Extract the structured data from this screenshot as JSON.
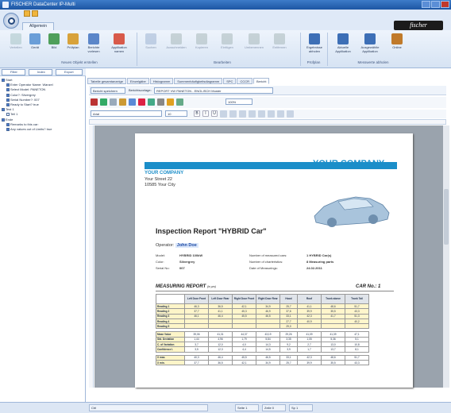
{
  "window": {
    "title": "FISCHER DataCenter IP-Multi"
  },
  "ribbon": {
    "tab_active": "Allgemein",
    "brand": "fischer",
    "buttons": [
      {
        "label": "Verteilen",
        "enabled": false
      },
      {
        "label": "Gerät",
        "enabled": true
      },
      {
        "label": "Bild",
        "enabled": true
      },
      {
        "label": "Prüfplan",
        "enabled": true
      },
      {
        "label": "Berichte vorlesen",
        "enabled": true
      },
      {
        "label": "Applikation namen",
        "enabled": true
      },
      {
        "label": "Suchen",
        "enabled": false
      },
      {
        "label": "Ausschneiden",
        "enabled": false
      },
      {
        "label": "Kopieren",
        "enabled": false
      },
      {
        "label": "Einfügen",
        "enabled": false
      },
      {
        "label": "Umbenennen",
        "enabled": false
      },
      {
        "label": "Entfernen",
        "enabled": false
      },
      {
        "label": "Ergebnisse abholen",
        "enabled": true
      },
      {
        "label": "Aktuelle Applikation",
        "enabled": true
      },
      {
        "label": "Ausgewählte Applikation",
        "enabled": true
      },
      {
        "label": "Online",
        "enabled": true
      }
    ],
    "groups": [
      "Neues Objekt erstellen",
      "Bearbeiten",
      "Prüfplan",
      "Messwerte abholen"
    ]
  },
  "left_panel": {
    "filter_label": "Filter",
    "index_label": "Index",
    "export_label": "Export",
    "tree": [
      {
        "indent": 0,
        "label": "Start",
        "checked": true
      },
      {
        "indent": 1,
        "label": "Enter Operator Name: Wanzel",
        "checked": true
      },
      {
        "indent": 1,
        "label": "Select Model: PANETON",
        "checked": true
      },
      {
        "indent": 1,
        "label": "Color?: Silvergrey",
        "checked": true
      },
      {
        "indent": 1,
        "label": "Serial Number?: 007",
        "checked": true
      },
      {
        "indent": 1,
        "label": "Ready to Start? true",
        "checked": true
      },
      {
        "indent": 0,
        "label": "Test 1",
        "checked": true
      },
      {
        "indent": 1,
        "label": "Teil 1",
        "checked": false
      },
      {
        "indent": 0,
        "label": "Ende",
        "checked": true
      },
      {
        "indent": 1,
        "label": "Remarks to this car:",
        "checked": true
      },
      {
        "indent": 1,
        "label": "Any values out of Limits? true",
        "checked": true
      }
    ]
  },
  "content_tabs": [
    "Tabelle gesamtanzeige",
    "Einzelgäbe",
    "Histogramm",
    "Summenhäufigkeitsdiagramm",
    "SPC",
    "CCCR",
    "Bericht"
  ],
  "content_tab_active_index": 6,
  "report_toolbar": {
    "print_button": "Bericht speichern",
    "template_label": "Berichtsvorlage:",
    "template_value": "REPORT VW PANETON - ENGLISCH Muster",
    "zoom_value": "100%",
    "font_value": "Arial",
    "size_value": "10"
  },
  "report": {
    "brand_big": "YOUR COMPANY",
    "company": "YOUR COMPANY",
    "street": "Your Street 22",
    "city": "10585 Your City",
    "title": "Inspection Report \"HYBRID Car\"",
    "operator_label": "Operator:",
    "operator_name": "John Doe",
    "meta_left": [
      {
        "k": "Model:",
        "v": "HYBRID 100kW"
      },
      {
        "k": "Color:",
        "v": "Silvergrey"
      },
      {
        "k": "Serial No:",
        "v": "007"
      }
    ],
    "meta_right": [
      {
        "k": "Number of measured cars:",
        "v": "1 HYBRID Car(s)"
      },
      {
        "k": "Number of charteristics:",
        "v": "8 Measuring parts"
      },
      {
        "k": "Date of Measurings:",
        "v": "24.02.2011"
      }
    ],
    "measuring_title": "MEASURING REPORT",
    "measuring_unit": "(in µm)",
    "car_no": "CAR No.: 1",
    "columns": [
      "",
      "Left Door Front",
      "Left Door Rear",
      "Right Door Front",
      "Right Door Rear",
      "Hood",
      "Roof",
      "Trunk above",
      "Trunk Tail"
    ],
    "rows": [
      [
        "Reading 1",
        "46,3",
        "36,5",
        "42,1",
        "34,9",
        "25,7",
        "41,1",
        "48,6",
        "51,7"
      ],
      [
        "Reading 2",
        "37,7",
        "41,1",
        "45,3",
        "46,9",
        "37,6",
        "39,9",
        "35,5",
        "43,3"
      ],
      [
        "Reading 3",
        "46,1",
        "46,4",
        "45,5",
        "46,5",
        "33,1",
        "42,3",
        "41,7",
        "51,3"
      ],
      [
        "Reading 4",
        "",
        "",
        "",
        "",
        "27,7",
        "40,9",
        "",
        "40,2"
      ],
      [
        "Reading 5",
        "",
        "",
        "",
        "",
        "29,0",
        "",
        "",
        ""
      ],
      [
        "",
        "",
        "",
        "",
        "",
        "",
        "",
        "",
        ""
      ],
      [
        "Mean Value",
        "39,06",
        "41,31",
        "44,37",
        "43,19",
        "29,26",
        "41,09",
        "41,39",
        "47,1"
      ],
      [
        "Std. Deviation",
        "1,44",
        "4,96",
        "1,79",
        "5,84",
        "3,35",
        "1,05",
        "5,36",
        "5,1"
      ],
      [
        "C. of Variation",
        "3,7",
        "12,0",
        "4,0",
        "14,3",
        "9,2",
        "2,7",
        "13,0",
        "10,8"
      ],
      [
        "Confidence I.",
        "3,5",
        "12,3",
        "4,4",
        "14,5",
        "3,9",
        "1,7",
        "13,7",
        "8,1"
      ],
      [
        "",
        "",
        "",
        "",
        "",
        "",
        "",
        "",
        ""
      ],
      [
        "X max.",
        "40,3",
        "46,4",
        "45,5",
        "46,5",
        "33,1",
        "42,3",
        "48,6",
        "51,7"
      ],
      [
        "X min.",
        "37,7",
        "36,5",
        "42,1",
        "34,9",
        "25,7",
        "39,9",
        "35,5",
        "43,3"
      ]
    ]
  },
  "status_bar": {
    "cell1": "Ctrl",
    "page_label": "Seite 1",
    "page_of": "Zeile 0",
    "col": "Sp 1"
  },
  "colors": {
    "accent": "#1b8ec9",
    "ribbon": "#dfe9f7",
    "title": "#1d56a3"
  }
}
